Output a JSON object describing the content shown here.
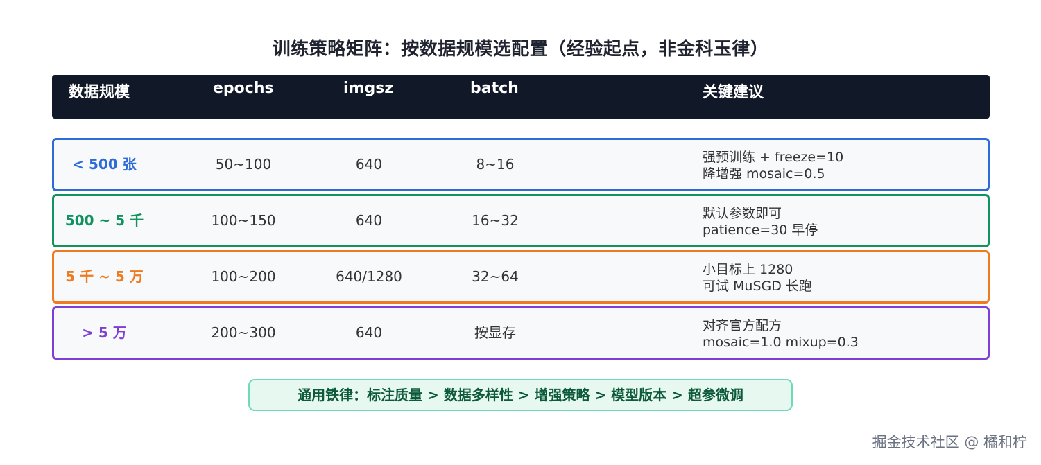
{
  "title": "训练策略矩阵：按数据规模选配置（经验起点，非金科玉律）",
  "header": {
    "scale": "数据规模",
    "epochs": "epochs",
    "imgsz": "imgsz",
    "batch": "batch",
    "advice": "关键建议"
  },
  "rows": [
    {
      "scale": "< 500 张",
      "epochs": "50~100",
      "imgsz": "640",
      "batch": "8~16",
      "advice1": "强预训练 + freeze=10",
      "advice2": "降增强 mosaic=0.5",
      "color": "#2e6bd6"
    },
    {
      "scale": "500 ~ 5 千",
      "epochs": "100~150",
      "imgsz": "640",
      "batch": "16~32",
      "advice1": "默认参数即可",
      "advice2": "patience=30 早停",
      "color": "#12925e"
    },
    {
      "scale": "5 千 ~ 5 万",
      "epochs": "100~200",
      "imgsz": "640/1280",
      "batch": "32~64",
      "advice1": "小目标上 1280",
      "advice2": "可试 MuSGD 长跑",
      "color": "#ee7b22"
    },
    {
      "scale": "> 5 万",
      "epochs": "200~300",
      "imgsz": "640",
      "batch": "按显存",
      "advice1": "对齐官方配方",
      "advice2": "mosaic=1.0 mixup=0.3",
      "color": "#7e3fd4"
    }
  ],
  "footer": "通用铁律：标注质量  >  数据多样性  >  增强策略  >  模型版本  >  超参微调",
  "watermark": "掘金技术社区 @ 橘和柠"
}
